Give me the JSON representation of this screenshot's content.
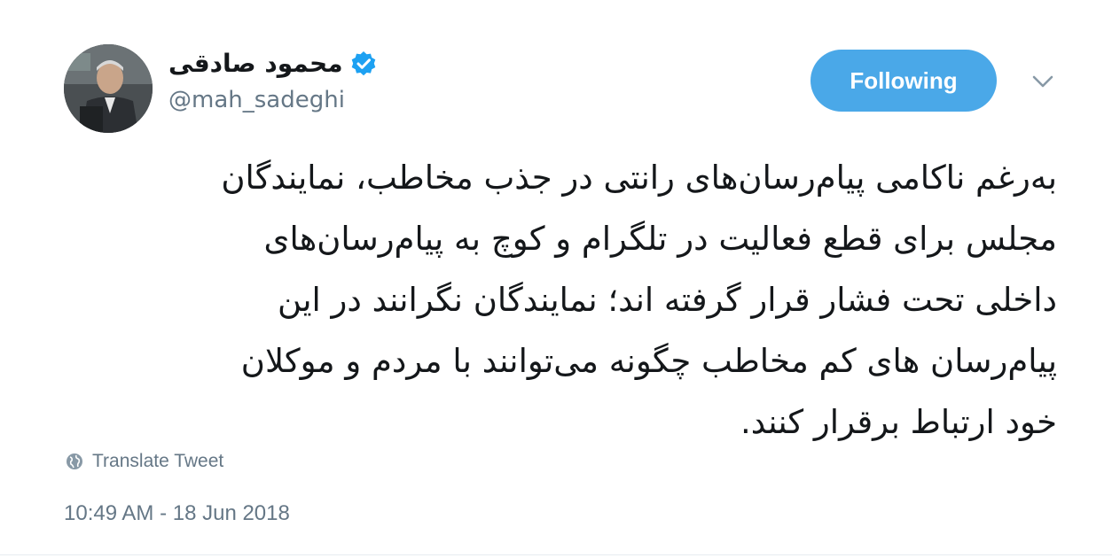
{
  "author": {
    "display_name": "محمود صادقی",
    "handle": "@mah_sadeghi",
    "verified_icon": "verified-badge-icon"
  },
  "actions": {
    "follow_label": "Following",
    "menu_icon": "chevron-down-icon"
  },
  "tweet": {
    "lines": [
      "به‌رغم ناکامی پیام‌رسان‌های رانتی در جذب مخاطب، نمایندگان",
      "مجلس برای قطع فعالیت در تلگرام و کوچ به پیام‌رسان‌های",
      "داخلی تحت فشار قرار گرفته اند؛ نمایندگان نگرانند در این",
      "پیام‌رسان های کم مخاطب چگونه می‌توانند با مردم و موکلان",
      "خود ارتباط برقرار کنند."
    ],
    "translate_label": "Translate Tweet",
    "timestamp": "10:49 AM - 18 Jun 2018"
  },
  "colors": {
    "accent": "#4aa8e8",
    "text": "#14171a",
    "muted": "#657786",
    "verified": "#1da1f2"
  }
}
